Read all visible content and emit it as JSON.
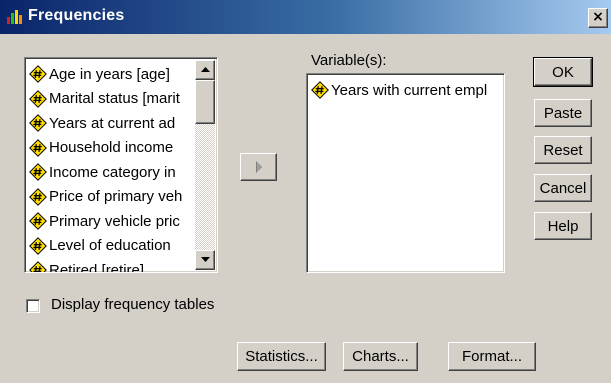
{
  "window": {
    "title": "Frequencies",
    "close_glyph": "×"
  },
  "source_list": {
    "items": [
      {
        "label": "Age in years [age]",
        "icon": "scale-variable-icon"
      },
      {
        "label": "Marital status [marit",
        "icon": "scale-variable-icon"
      },
      {
        "label": "Years at current ad",
        "icon": "scale-variable-icon"
      },
      {
        "label": "Household income",
        "icon": "scale-variable-icon"
      },
      {
        "label": "Income category in",
        "icon": "scale-variable-icon"
      },
      {
        "label": "Price of primary veh",
        "icon": "scale-variable-icon"
      },
      {
        "label": "Primary vehicle pric",
        "icon": "scale-variable-icon"
      },
      {
        "label": "Level of education",
        "icon": "scale-variable-icon"
      },
      {
        "label": "Retired [retire]",
        "icon": "scale-variable-icon"
      }
    ]
  },
  "move_button": {
    "icon": "right-arrow-icon"
  },
  "variables": {
    "label": "Variable(s):",
    "items": [
      {
        "label": "Years with current empl",
        "icon": "scale-variable-icon"
      }
    ]
  },
  "buttons": {
    "ok": "OK",
    "paste": "Paste",
    "reset": "Reset",
    "cancel": "Cancel",
    "help": "Help"
  },
  "display_frequency": {
    "label": "Display frequency tables",
    "checked": false
  },
  "bottom_buttons": {
    "statistics": "Statistics...",
    "charts": "Charts...",
    "format": "Format..."
  },
  "colors": {
    "titlebar_start": "#0a246a",
    "titlebar_end": "#a6caf0",
    "dialog_bg": "#d4d0c8",
    "icon_yellow": "#ffdd00"
  }
}
